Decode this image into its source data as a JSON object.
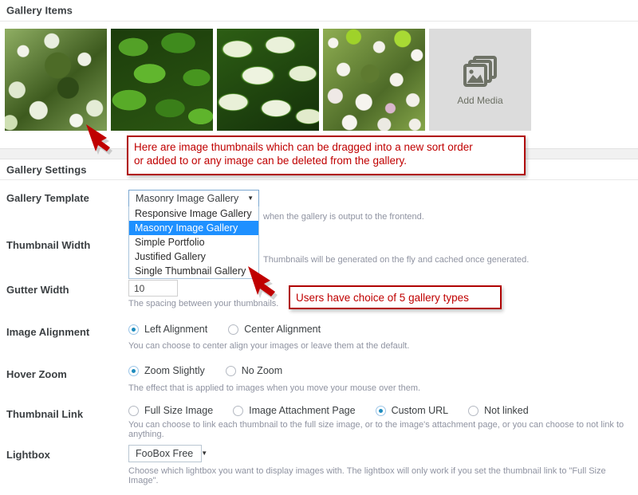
{
  "sections": {
    "gallery_items_title": "Gallery Items",
    "gallery_settings_title": "Gallery Settings"
  },
  "gallery_items": {
    "thumbnails": [
      {
        "name": "thumbnail-1",
        "alt": "White blossom tree foliage"
      },
      {
        "name": "thumbnail-2",
        "alt": "Dark green leaves"
      },
      {
        "name": "thumbnail-3",
        "alt": "Variegated green and cream leaves"
      },
      {
        "name": "thumbnail-4",
        "alt": "Pink and white flowering shrub"
      }
    ],
    "add_media_label": "Add Media",
    "add_media_icon": "stacked-images-icon"
  },
  "settings": {
    "gallery_template": {
      "label": "Gallery Template",
      "value": "Masonry Image Gallery",
      "dropdown_open": true,
      "options": [
        "Responsive Image Gallery",
        "Masonry Image Gallery",
        "Simple Portfolio",
        "Justified Gallery",
        "Single Thumbnail Gallery"
      ],
      "selected_index": 1,
      "description_visible_fragment": "when the gallery is output to the frontend."
    },
    "thumbnail_width": {
      "label": "Thumbnail Width",
      "description_visible_fragment": "Thumbnails will be generated on the fly and cached once generated."
    },
    "gutter_width": {
      "label": "Gutter Width",
      "value": "10",
      "description": "The spacing between your thumbnails."
    },
    "image_alignment": {
      "label": "Image Alignment",
      "options": [
        "Left Alignment",
        "Center Alignment"
      ],
      "selected_index": 0,
      "description": "You can choose to center align your images or leave them at the default."
    },
    "hover_zoom": {
      "label": "Hover Zoom",
      "options": [
        "Zoom Slightly",
        "No Zoom"
      ],
      "selected_index": 0,
      "description": "The effect that is applied to images when you move your mouse over them."
    },
    "thumbnail_link": {
      "label": "Thumbnail Link",
      "options": [
        "Full Size Image",
        "Image Attachment Page",
        "Custom URL",
        "Not linked"
      ],
      "selected_index": 2,
      "description": "You can choose to link each thumbnail to the full size image, or to the image's attachment page, or you can choose to not link to anything."
    },
    "lightbox": {
      "label": "Lightbox",
      "value": "FooBox Free",
      "description": "Choose which lightbox you want to display images with. The lightbox will only work if you set the thumbnail link to \"Full Size Image\"."
    }
  },
  "annotations": {
    "callout_1_line_1": "Here are image thumbnails which can be dragged into a new sort order",
    "callout_1_line_2": "or added to or any image can  be deleted from the gallery.",
    "callout_2": "Users have choice of 5 gallery types",
    "color": "#c00000"
  }
}
